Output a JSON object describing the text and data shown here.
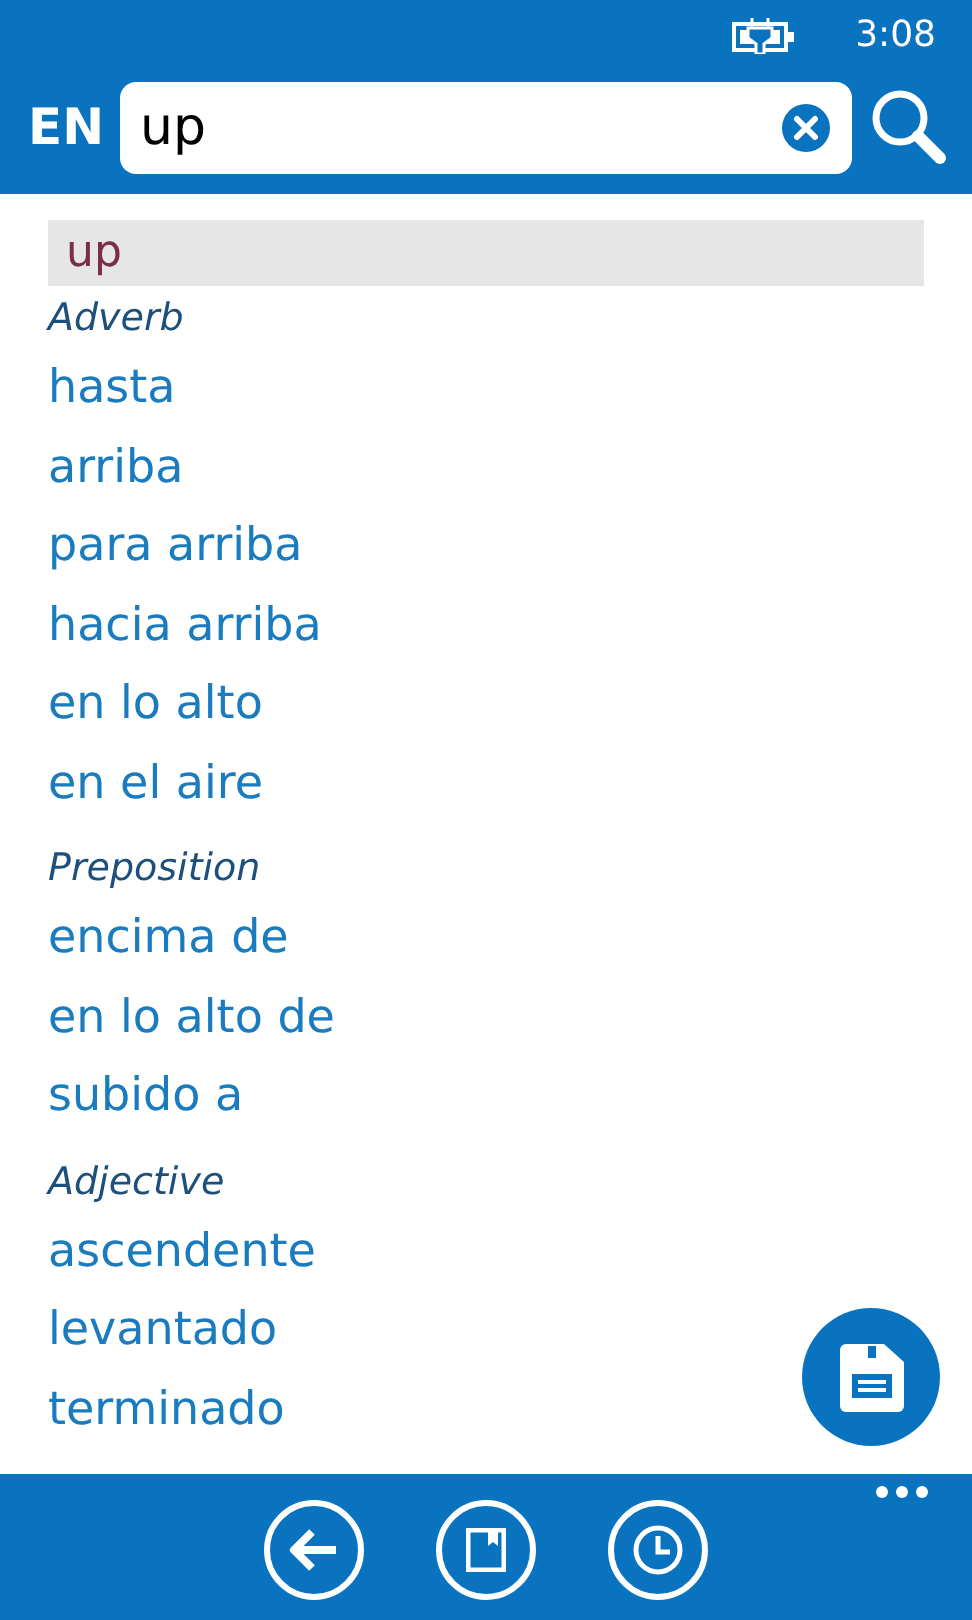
{
  "status_bar": {
    "time": "3:08"
  },
  "header": {
    "language": "EN",
    "query": "up"
  },
  "headword": "up",
  "sections": [
    {
      "pos": "Adverb",
      "translations": [
        "hasta",
        "arriba",
        "para arriba",
        "hacia arriba",
        "en lo alto",
        "en el aire"
      ]
    },
    {
      "pos": "Preposition",
      "translations": [
        "encima de",
        "en lo alto de",
        "subido a"
      ]
    },
    {
      "pos": "Adjective",
      "translations": [
        "ascendente",
        "levantado",
        "terminado"
      ]
    }
  ]
}
